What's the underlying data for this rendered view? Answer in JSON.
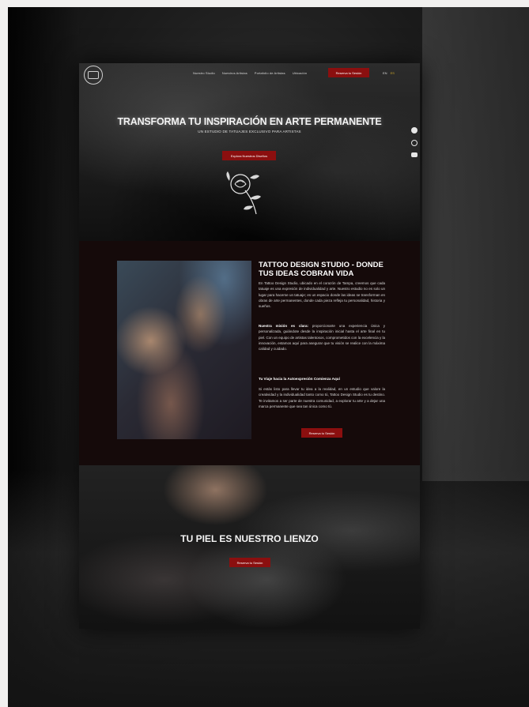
{
  "nav": {
    "items": [
      "Nuestro Studio",
      "Nuestros Artistas",
      "Portafolio de Artistas",
      "Ubicación"
    ],
    "cta": "Reserva tu Sesión",
    "languages": [
      "EN",
      "ES"
    ]
  },
  "hero": {
    "title": "TRANSFORMA TU INSPIRACIÓN EN ARTE PERMANENTE",
    "subtitle": "UN ESTUDIO DE TATUAJES EXCLUSIVO PARA ARTISTAS",
    "cta": "Explora Nuestros Diseños"
  },
  "about": {
    "title": "TATTOO DESIGN STUDIO - DONDE TUS IDEAS COBRAN VIDA",
    "p1": "En Tattoo Design Studio, ubicado en el corazón de Tampa, creemos que cada tatuaje es una expresión de individualidad y arte. Nuestro estudio no es solo un lugar para hacerse un tatuaje; es un espacio donde las ideas se transforman en obras de arte permanentes, donde cada pieza refleja tu personalidad, historia y sueños.",
    "p2_strong": "Nuestra misión es clara:",
    "p2": " proporcionarte una experiencia única y personalizada, guiándote desde la inspiración inicial hasta el arte final en tu piel. Con un equipo de artistas talentosos, comprometidos con la excelencia y la innovación, estamos aquí para asegurar que tu visión se realice con la máxima calidad y cuidado.",
    "heading": "Tu Viaje hacia la Autoexpresión Comienza Aquí",
    "p3": "Si estás listo para llevar tu idea a la realidad, en un estudio que valore la creatividad y la individualidad tanto como tú, Tattoo Design Studio es tu destino. Te invitamos a ser parte de nuestra comunidad, a explorar tu arte y a dejar una marca permanente que sea tan única como tú.",
    "cta": "Reserva tu Sesión"
  },
  "banner": {
    "title": "TU PIEL ES NUESTRO LIENZO",
    "cta": "Reserva tu Sesión"
  },
  "social": [
    "facebook-icon",
    "instagram-icon",
    "youtube-icon"
  ]
}
